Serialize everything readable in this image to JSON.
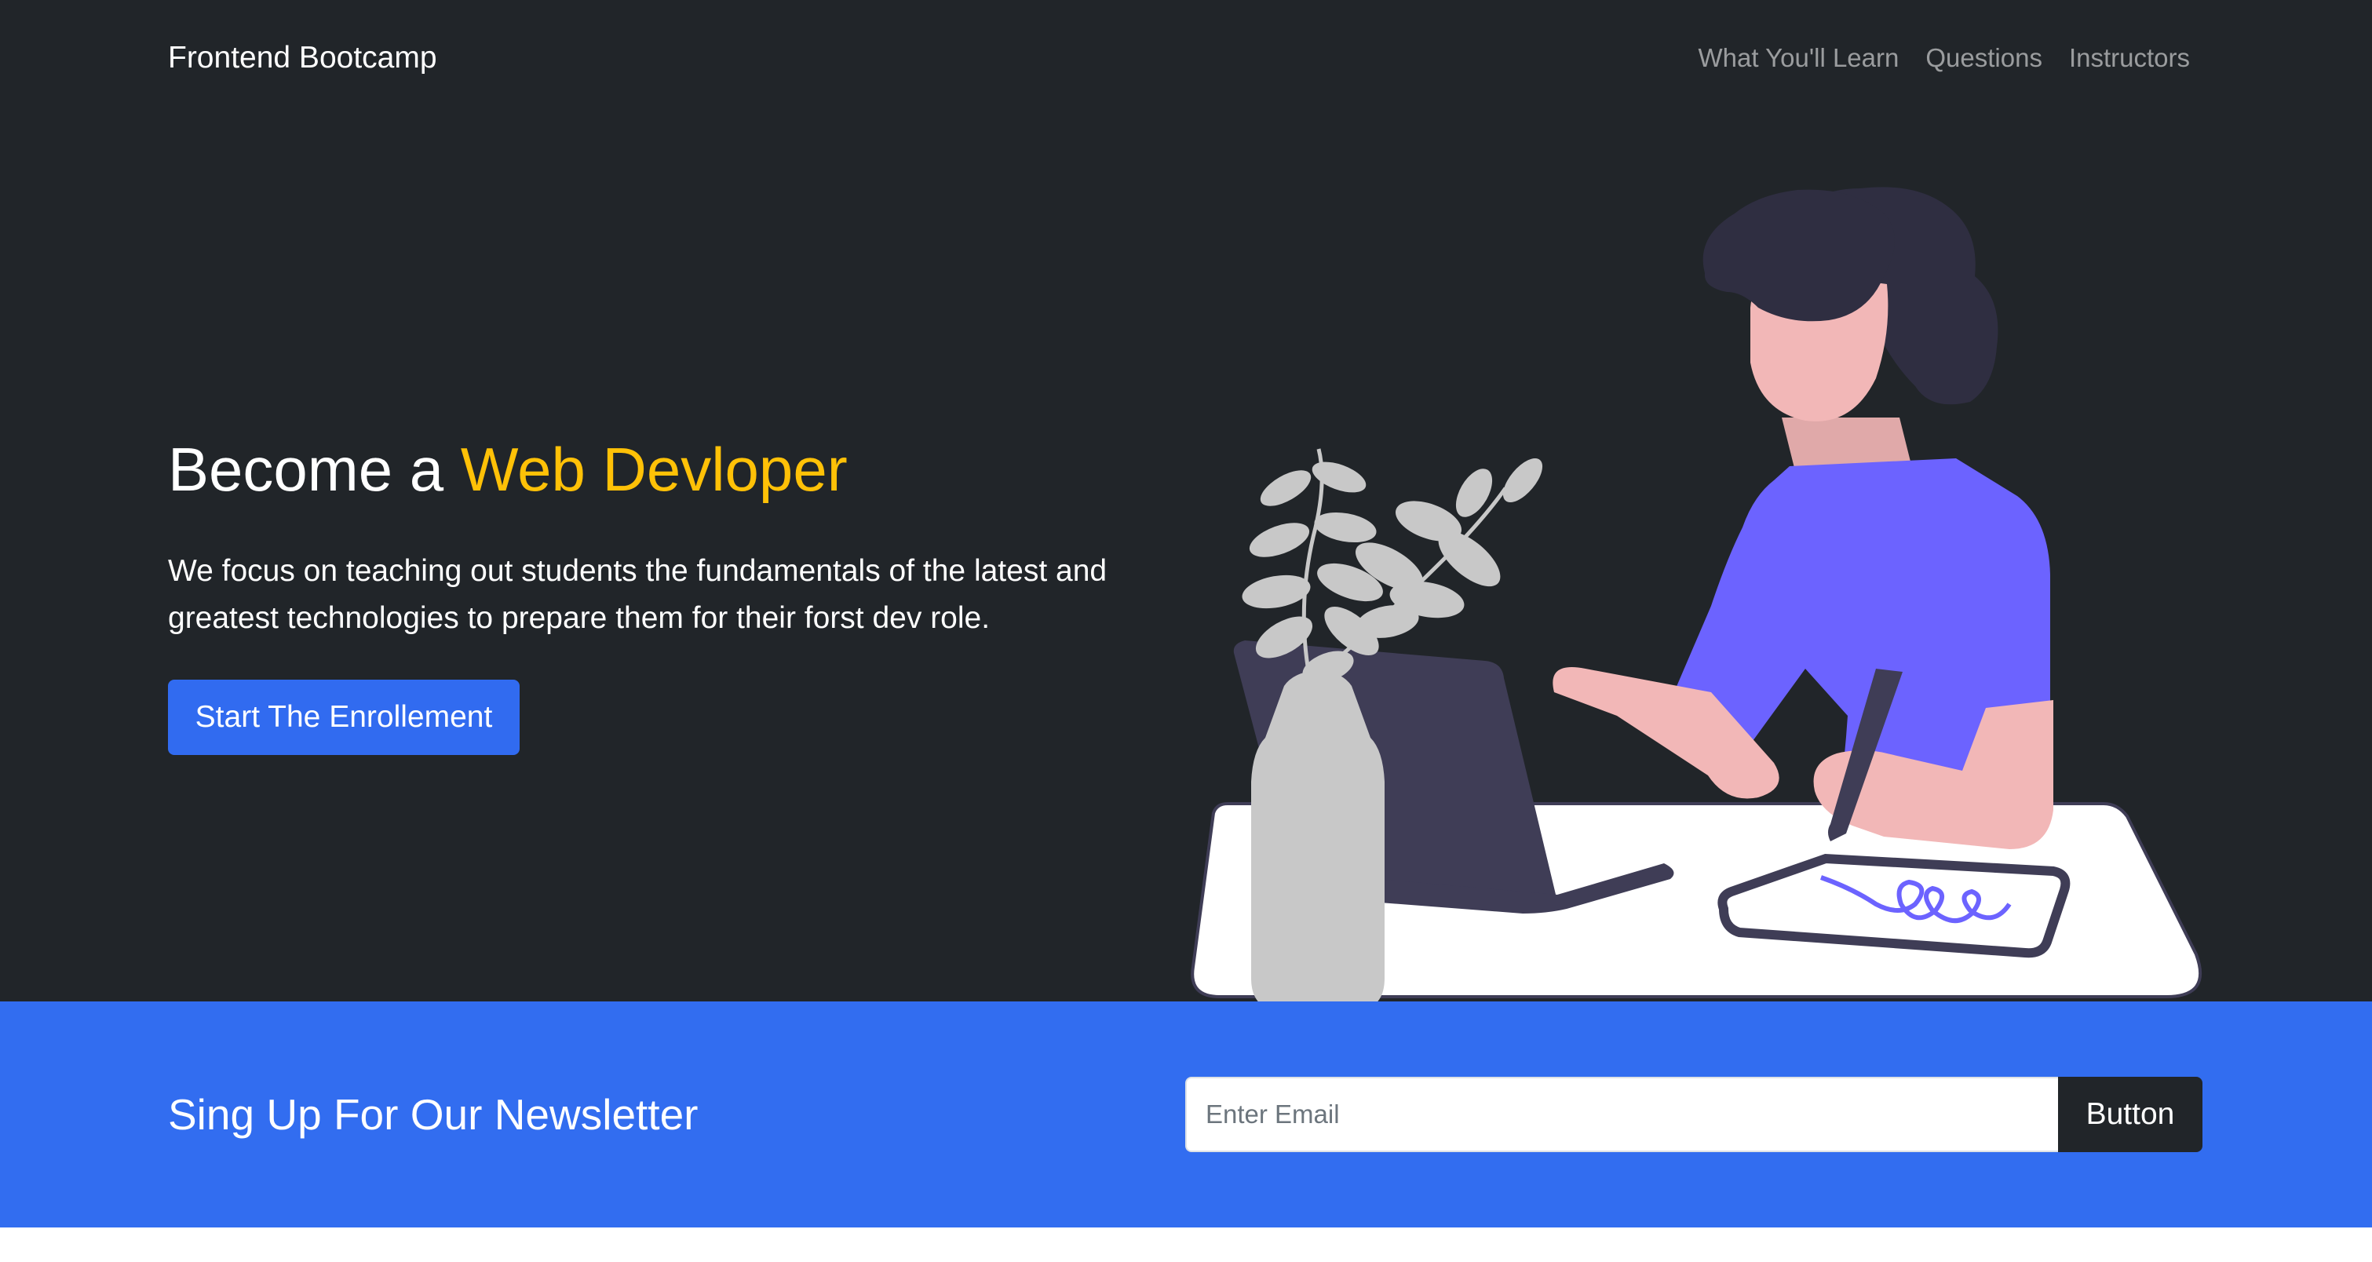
{
  "navbar": {
    "brand": "Frontend Bootcamp",
    "links": [
      {
        "label": "What You'll Learn"
      },
      {
        "label": "Questions"
      },
      {
        "label": "Instructors"
      }
    ]
  },
  "hero": {
    "title_prefix": "Become a ",
    "title_highlight": "Web Devloper",
    "lead": "We focus on teaching out students the fundamentals of the latest and greatest technologies to prepare them for their forst dev role.",
    "cta_label": "Start The Enrollement",
    "illustration": "person-working-at-desk-illustration"
  },
  "newsletter": {
    "title": "Sing Up For Our Newsletter",
    "email_placeholder": "Enter Email",
    "button_label": "Button"
  },
  "colors": {
    "dark_bg": "#212529",
    "accent_yellow": "#ffc107",
    "primary_blue": "#316bf0",
    "illustration_purple": "#6c63ff"
  }
}
